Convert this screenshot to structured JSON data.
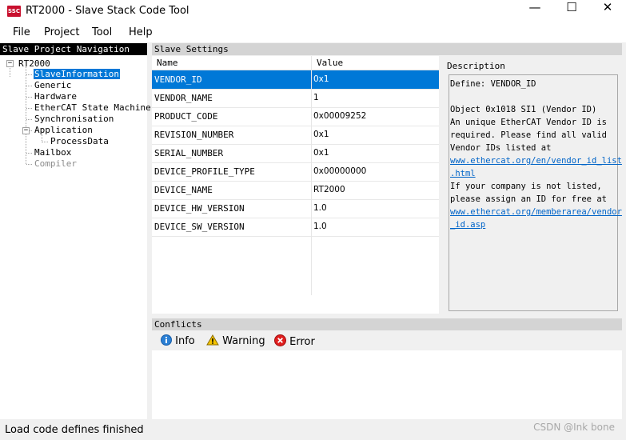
{
  "window": {
    "app_icon_text": "SSC",
    "title": "RT2000 - Slave Stack Code Tool",
    "minimize": "—",
    "maximize": "☐",
    "close": "✕"
  },
  "menu": {
    "file": "File",
    "project": "Project",
    "tool": "Tool",
    "help": "Help"
  },
  "navigation": {
    "header": "Slave Project Navigation",
    "root": "RT2000",
    "collapse_glyph": "−",
    "items": [
      {
        "label": "SlaveInformation"
      },
      {
        "label": "Generic"
      },
      {
        "label": "Hardware"
      },
      {
        "label": "EtherCAT State Machine"
      },
      {
        "label": "Synchronisation"
      },
      {
        "label": "Application"
      },
      {
        "label": "ProcessData"
      },
      {
        "label": "Mailbox"
      },
      {
        "label": "Compiler"
      }
    ]
  },
  "settings": {
    "header": "Slave Settings",
    "columns": {
      "name": "Name",
      "value": "Value"
    },
    "rows": [
      {
        "name": "VENDOR_ID",
        "value": "0x1"
      },
      {
        "name": "VENDOR_NAME",
        "value": "1"
      },
      {
        "name": "PRODUCT_CODE",
        "value": "0x00009252"
      },
      {
        "name": "REVISION_NUMBER",
        "value": "0x1"
      },
      {
        "name": "SERIAL_NUMBER",
        "value": "0x1"
      },
      {
        "name": "DEVICE_PROFILE_TYPE",
        "value": "0x00000000"
      },
      {
        "name": "DEVICE_NAME",
        "value": "RT2000"
      },
      {
        "name": "DEVICE_HW_VERSION",
        "value": "1.0"
      },
      {
        "name": "DEVICE_SW_VERSION",
        "value": "1.0"
      }
    ]
  },
  "description": {
    "label": "Description",
    "define": "Define: VENDOR_ID",
    "object": "Object 0x1018 SI1 (Vendor ID)",
    "line1": "An unique EtherCAT Vendor ID is",
    "line2": "required. Please find all valid",
    "line3": "Vendor IDs listed at",
    "link1a": "www.ethercat.org/en/vendor_id_list",
    "link1b": ".html",
    "line4": "If your company is not listed,",
    "line5": "please assign an ID for free at",
    "link2a": "www.ethercat.org/memberarea/vendor",
    "link2b": "_id.asp"
  },
  "conflicts": {
    "header": "Conflicts",
    "info": "Info",
    "warning": "Warning",
    "error": "Error"
  },
  "status": {
    "text": "Load code defines finished",
    "watermark": "CSDN @Ink bone"
  },
  "colors": {
    "selection": "#0078d7",
    "header_bg": "#d4d4d4",
    "nav_header_bg": "#000000",
    "link": "#0064c8"
  }
}
